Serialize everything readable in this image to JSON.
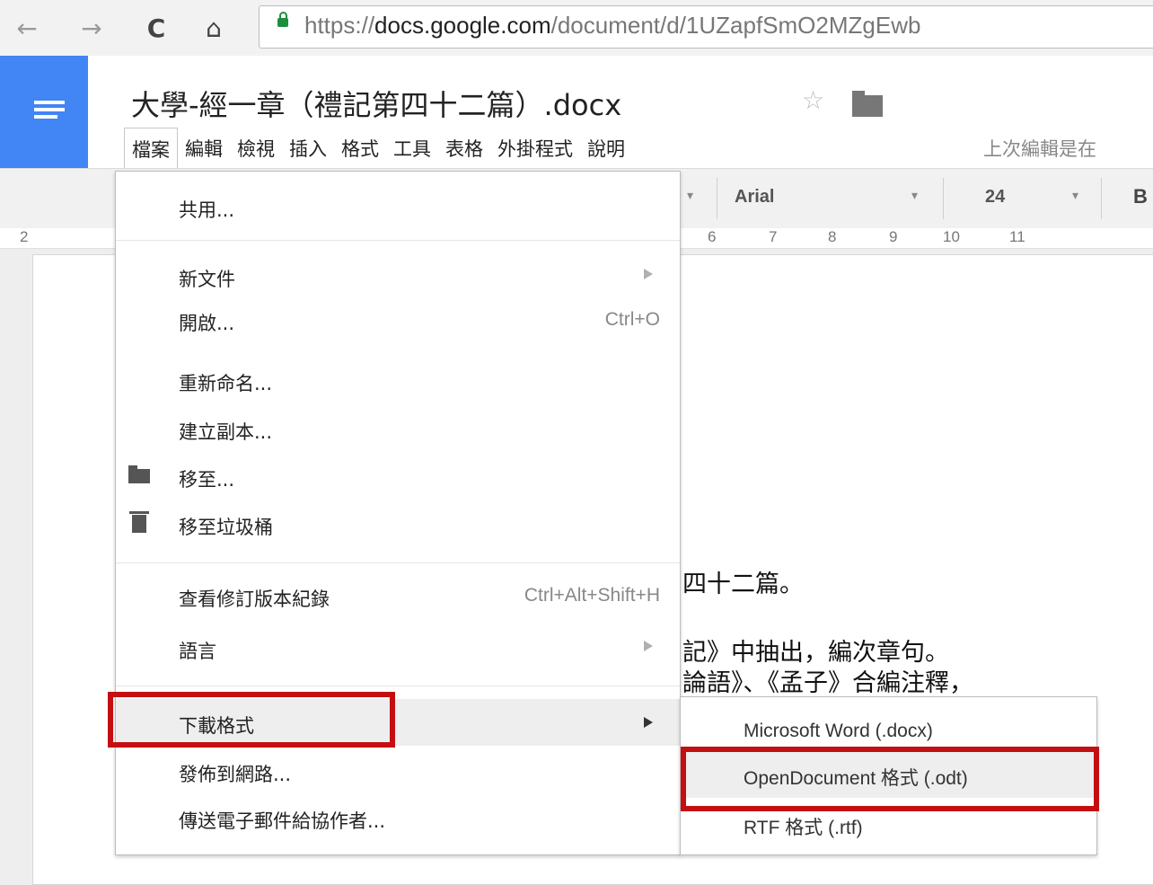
{
  "browser": {
    "url_prefix": "https://",
    "url_host": "docs.google.com",
    "url_path": "/document/d/1UZapfSmO2MZgEwb"
  },
  "doc": {
    "title": "大學-經一章（禮記第四十二篇）.docx",
    "menus": [
      "檔案",
      "編輯",
      "檢視",
      "插入",
      "格式",
      "工具",
      "表格",
      "外掛程式",
      "說明"
    ],
    "last_edit": "上次編輯是在"
  },
  "toolbar": {
    "font": "Arial",
    "size": "24",
    "bold": "B"
  },
  "ruler": [
    "2",
    "6",
    "7",
    "8",
    "9",
    "10",
    "11"
  ],
  "body_text": {
    "line1": "四十二篇。",
    "line2": "記》中抽出，編次章句。",
    "line3": "論語》、《孟子》合編注釋，"
  },
  "file_menu": {
    "share": "共用...",
    "new": "新文件",
    "open": "開啟...",
    "open_shortcut": "Ctrl+O",
    "rename": "重新命名...",
    "copy": "建立副本...",
    "move": "移至...",
    "trash": "移至垃圾桶",
    "revisions": "查看修訂版本紀錄",
    "revisions_shortcut": "Ctrl+Alt+Shift+H",
    "language": "語言",
    "download": "下載格式",
    "publish": "發佈到網路...",
    "email": "傳送電子郵件給協作者..."
  },
  "download_menu": {
    "docx": "Microsoft Word (.docx)",
    "odt": "OpenDocument 格式 (.odt)",
    "rtf": "RTF 格式 (.rtf)"
  },
  "colors": {
    "docs_blue": "#4285f4",
    "highlight_red": "#c40f12"
  }
}
